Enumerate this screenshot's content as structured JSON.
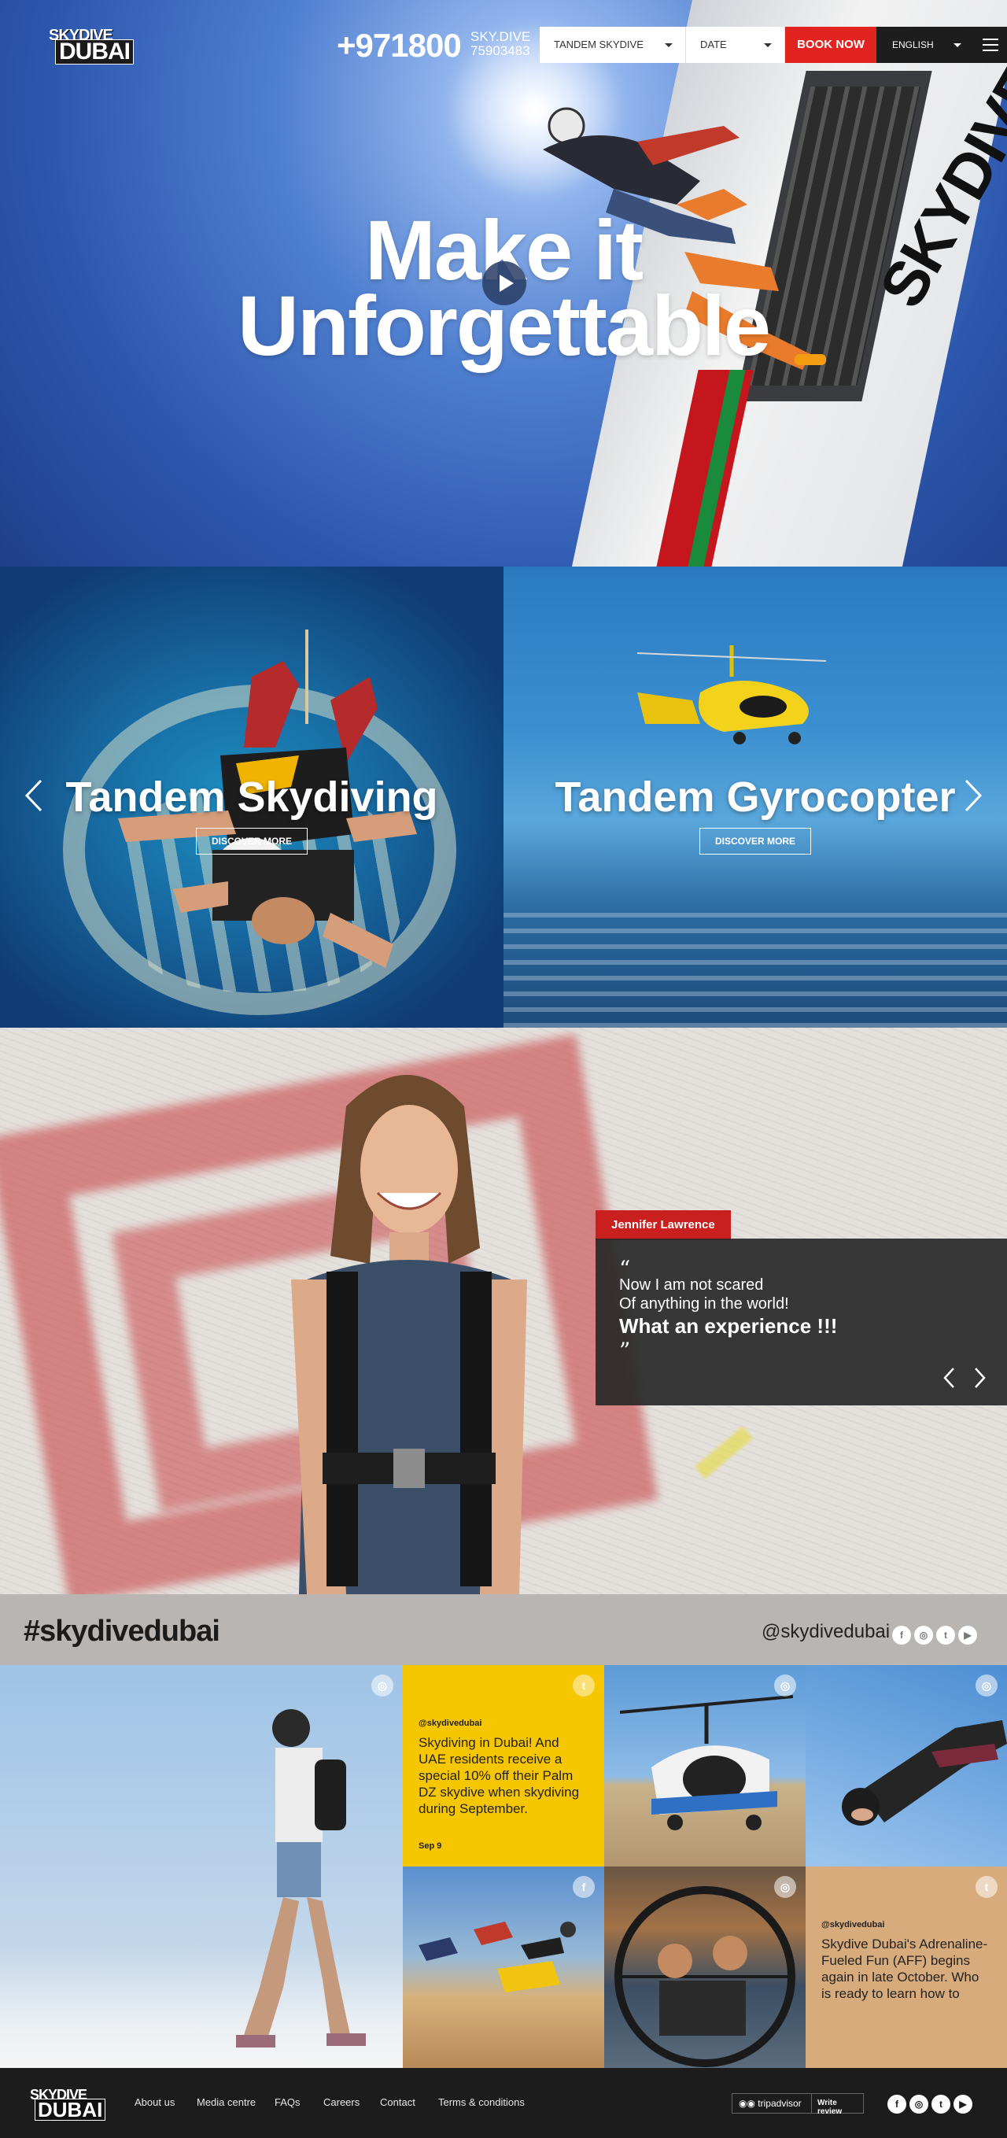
{
  "header": {
    "logo": {
      "line1": "SKYDIVE",
      "line2": "DUBAI"
    },
    "phone": "+971800",
    "phone_alt_line1": "SKY.DIVE",
    "phone_alt_line2": "75903483",
    "activity_select": "TANDEM SKYDIVE",
    "date_select": "DATE",
    "book_label": "BOOK NOW",
    "language": "ENGLISH",
    "menu_icon": "hamburger-icon"
  },
  "hero": {
    "title_line1": "Make it",
    "title_line2": "Unforgettable",
    "plane_text": "SKYDIVE",
    "play_icon": "play-icon"
  },
  "products": [
    {
      "title": "Tandem Skydiving",
      "button": "DISCOVER MORE"
    },
    {
      "title": "Tandem Gyrocopter",
      "button": "DISCOVER MORE"
    }
  ],
  "testimonial": {
    "name": "Jennifer Lawrence",
    "line1": "Now I am not scared",
    "line2": "Of anything in the world!",
    "line3": "What an experience !!!",
    "open_quote": "“",
    "close_quote": "”"
  },
  "social": {
    "hashtag": "#skydivedubai",
    "handle": "@skydivedubai",
    "icons": [
      "facebook-icon",
      "instagram-icon",
      "twitter-icon",
      "youtube-icon"
    ]
  },
  "feed": {
    "tweet1": {
      "handle": "@skydivedubai",
      "text": "Skydiving in Dubai! And UAE residents receive a special 10% off their Palm DZ skydive when skydiving during September.",
      "date": "Sep 9"
    },
    "tweet2": {
      "handle": "@skydivedubai",
      "text": "Skydive Dubai's Adrenaline-Fueled Fun (AFF) begins again in late October. Who is ready to learn how to"
    }
  },
  "footer": {
    "links": [
      "About us",
      "Media centre",
      "FAQs",
      "Careers",
      "Contact",
      "Terms & conditions"
    ],
    "tripadvisor": "tripadvisor",
    "write_review": "Write review"
  },
  "colors": {
    "accent_red": "#e1241f",
    "tweet_yellow": "#f6c600",
    "tweet_tan": "#d7ab7b",
    "dark": "#1c1c1c"
  }
}
